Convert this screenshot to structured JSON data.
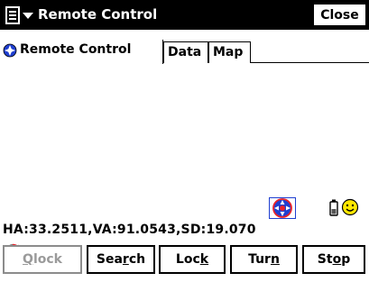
{
  "window": {
    "title": "Remote Control",
    "close_label": "Close"
  },
  "tabs": [
    {
      "label": "Remote Control",
      "active": true
    },
    {
      "label": "Data",
      "active": false
    },
    {
      "label": "Map",
      "active": false
    }
  ],
  "readout": "HA:33.2511,VA:91.0543,SD:19.070",
  "buttons": [
    {
      "pre": "",
      "u": "Q",
      "post": "lock",
      "enabled": false
    },
    {
      "pre": "Sea",
      "u": "r",
      "post": "ch",
      "enabled": true
    },
    {
      "pre": "Loc",
      "u": "k",
      "post": "",
      "enabled": true
    },
    {
      "pre": "Tur",
      "u": "n",
      "post": "",
      "enabled": true
    },
    {
      "pre": "St",
      "u": "o",
      "post": "p",
      "enabled": true
    }
  ],
  "icons": {
    "start": "windows-start-icon",
    "tab": "prism-target-icon",
    "prism": "prism-target-icon",
    "battery": "battery-icon",
    "status": "smiley-face-icon",
    "spinner": "refresh-spinner-icon"
  },
  "colors": {
    "titlebar": "#000000",
    "prism_blue": "#1f3fd0",
    "prism_red": "#e8222a",
    "smile_yellow": "#ffe800",
    "spinner_red": "#e8222a",
    "disabled_text": "#9a9a9a"
  }
}
